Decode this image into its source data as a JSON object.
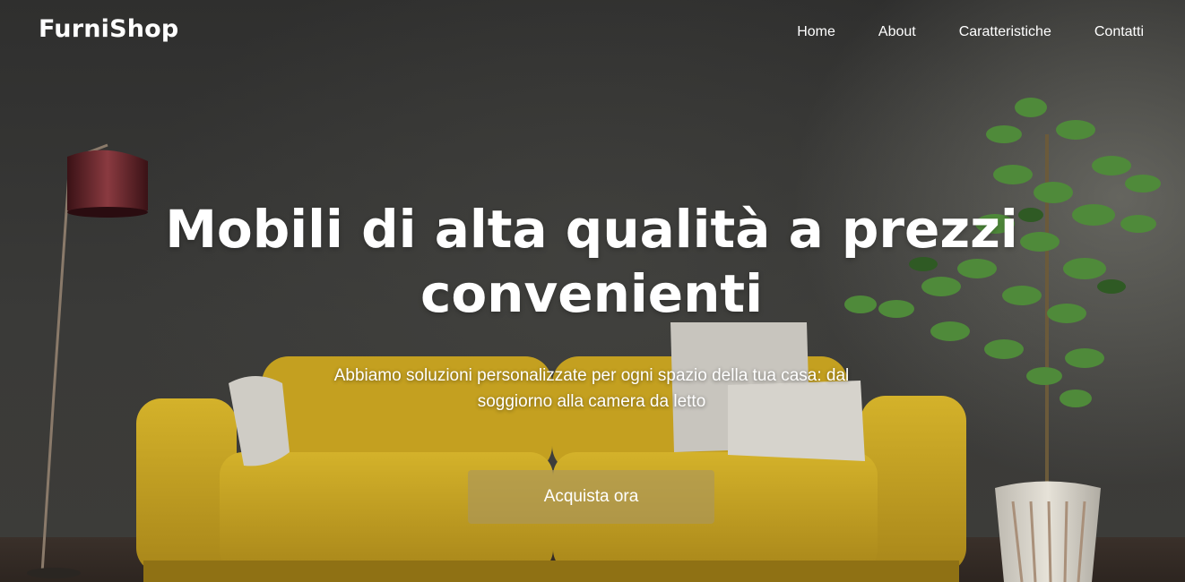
{
  "brand": {
    "name": "FurniShop"
  },
  "nav": {
    "items": [
      {
        "label": "Home"
      },
      {
        "label": "About"
      },
      {
        "label": "Caratteristiche"
      },
      {
        "label": "Contatti"
      }
    ]
  },
  "hero": {
    "title": "Mobili di alta qualità a prezzi convenienti",
    "subtitle": "Abbiamo soluzioni personalizzate per ogni spazio della tua casa: dal soggiorno alla camera da letto",
    "cta_label": "Acquista ora"
  },
  "colors": {
    "wall": "#3a3a38",
    "sofa": "#c9a51c",
    "cta_background": "rgba(170,150,95,0.62)",
    "lamp_shade": "#5a1f25",
    "plant": "#4f8a3a",
    "text": "#ffffff"
  },
  "scene_objects": [
    "floor-lamp",
    "yellow-sofa",
    "cushions",
    "potted-plant"
  ]
}
